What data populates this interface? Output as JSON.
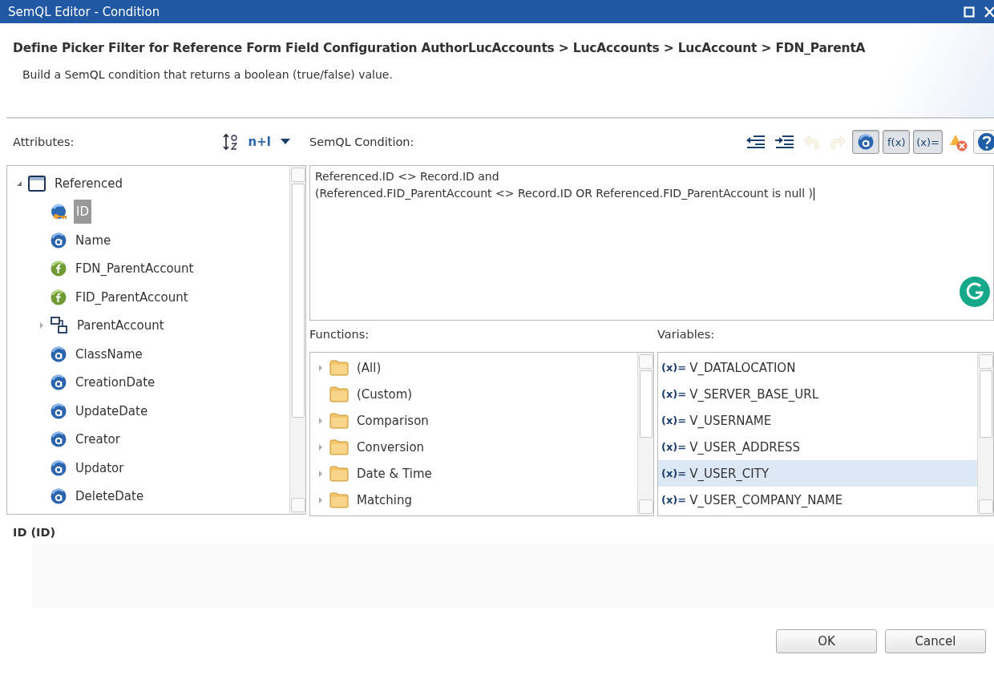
{
  "window": {
    "title": "SemQL Editor - Condition"
  },
  "header": {
    "title": "Define Picker Filter for Reference Form Field Configuration AuthorLucAccounts > LucAccounts > LucAccount > FDN_ParentA",
    "description": "Build a SemQL condition that returns a boolean (true/false) value."
  },
  "attributes": {
    "label": "Attributes:",
    "name_toggle": "n+l",
    "tree": [
      {
        "label": "Referenced",
        "kind": "entity",
        "expanded": true,
        "selected": false,
        "children": [
          {
            "label": "ID",
            "kind": "key",
            "selected": true
          },
          {
            "label": "Name",
            "kind": "attribute",
            "selected": false
          },
          {
            "label": "FDN_ParentAccount",
            "kind": "formula",
            "selected": false
          },
          {
            "label": "FID_ParentAccount",
            "kind": "formula",
            "selected": false
          },
          {
            "label": "ParentAccount",
            "kind": "reference",
            "expanded": false,
            "selected": false
          },
          {
            "label": "ClassName",
            "kind": "attribute",
            "selected": false
          },
          {
            "label": "CreationDate",
            "kind": "attribute",
            "selected": false
          },
          {
            "label": "UpdateDate",
            "kind": "attribute",
            "selected": false
          },
          {
            "label": "Creator",
            "kind": "attribute",
            "selected": false
          },
          {
            "label": "Updator",
            "kind": "attribute",
            "selected": false
          },
          {
            "label": "DeleteDate",
            "kind": "attribute",
            "selected": false
          }
        ]
      }
    ]
  },
  "condition": {
    "label": "SemQL Condition:",
    "toolbar": [
      {
        "kind": "outdent"
      },
      {
        "kind": "indent"
      },
      {
        "kind": "undo",
        "disabled": true
      },
      {
        "kind": "redo",
        "disabled": true
      },
      {
        "kind": "attribute-toggle",
        "on": true
      },
      {
        "kind": "text-toggle",
        "text": "f(x)",
        "on": true
      },
      {
        "kind": "text-toggle",
        "text": "(x)=",
        "on": true
      },
      {
        "kind": "validate"
      },
      {
        "kind": "help"
      }
    ],
    "lines": [
      "Referenced.ID <> Record.ID and",
      "(Referenced.FID_ParentAccount <> Record.ID OR Referenced.FID_ParentAccount is null )"
    ]
  },
  "functions": {
    "label": "Functions:",
    "items": [
      {
        "label": "(All)",
        "expanded": false,
        "selected": false
      },
      {
        "label": "(Custom)",
        "selected": false
      },
      {
        "label": "Comparison",
        "expanded": false,
        "selected": false
      },
      {
        "label": "Conversion",
        "expanded": false,
        "selected": false
      },
      {
        "label": "Date & Time",
        "expanded": false,
        "selected": false
      },
      {
        "label": "Matching",
        "expanded": false,
        "selected": false
      }
    ]
  },
  "variables": {
    "label": "Variables:",
    "items": [
      {
        "prefix": "(x)=",
        "name": "V_DATALOCATION",
        "selected": false
      },
      {
        "prefix": "(x)=",
        "name": "V_SERVER_BASE_URL",
        "selected": false
      },
      {
        "prefix": "(x)=",
        "name": "V_USERNAME",
        "selected": false
      },
      {
        "prefix": "(x)=",
        "name": "V_USER_ADDRESS",
        "selected": false
      },
      {
        "prefix": "(x)=",
        "name": "V_USER_CITY",
        "selected": true
      },
      {
        "prefix": "(x)=",
        "name": "V_USER_COMPANY_NAME",
        "selected": false
      }
    ]
  },
  "details": {
    "title": "ID (ID)"
  },
  "buttons": [
    {
      "label": "OK"
    },
    {
      "label": "Cancel"
    }
  ]
}
